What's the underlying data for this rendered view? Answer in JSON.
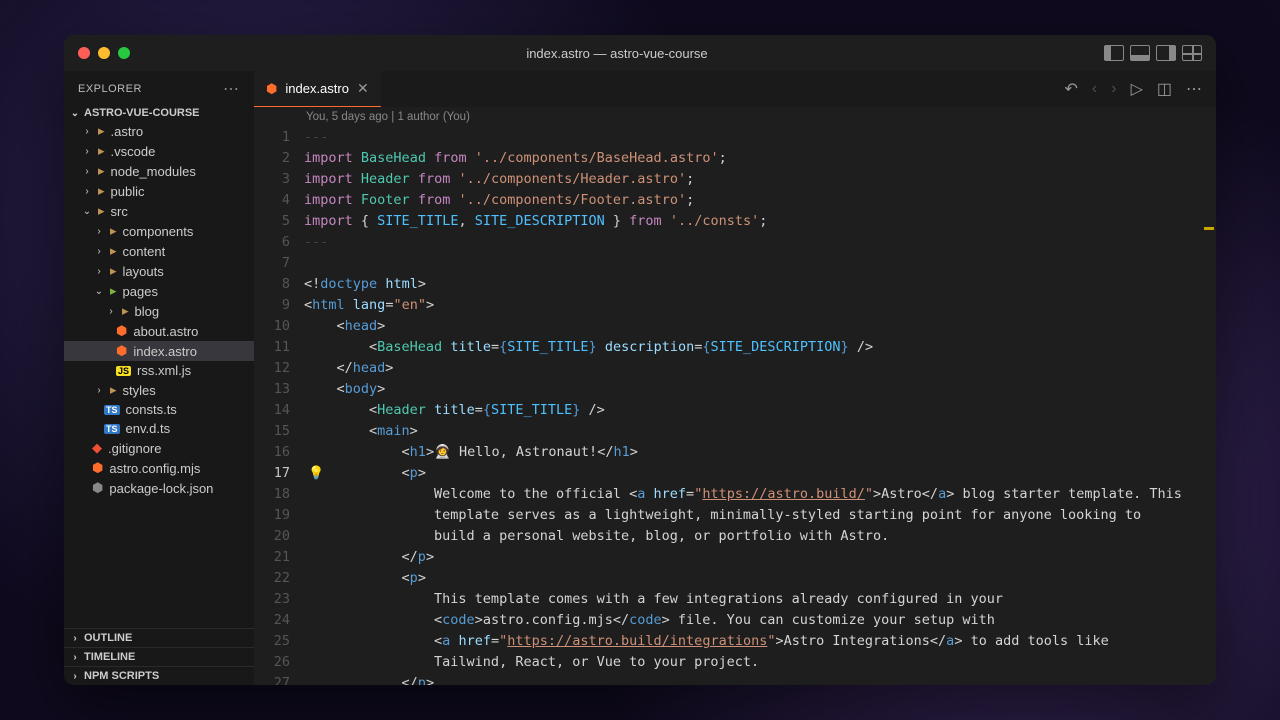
{
  "title": "index.astro — astro-vue-course",
  "traffic": {
    "close": "#ff5f57",
    "min": "#febc2e",
    "max": "#28c840"
  },
  "sidebar": {
    "explorer": "EXPLORER",
    "project": "ASTRO-VUE-COURSE",
    "tree": [
      {
        "pad": 18,
        "chev": "›",
        "icon": "fold",
        "label": ".astro"
      },
      {
        "pad": 18,
        "chev": "›",
        "icon": "fold",
        "label": ".vscode"
      },
      {
        "pad": 18,
        "chev": "›",
        "icon": "fold",
        "label": "node_modules"
      },
      {
        "pad": 18,
        "chev": "›",
        "icon": "fold",
        "label": "public"
      },
      {
        "pad": 18,
        "chev": "⌄",
        "icon": "fold",
        "label": "src"
      },
      {
        "pad": 30,
        "chev": "›",
        "icon": "fold",
        "label": "components"
      },
      {
        "pad": 30,
        "chev": "›",
        "icon": "fold",
        "label": "content"
      },
      {
        "pad": 30,
        "chev": "›",
        "icon": "fold",
        "label": "layouts"
      },
      {
        "pad": 30,
        "chev": "⌄",
        "icon": "fold pages",
        "label": "pages"
      },
      {
        "pad": 42,
        "chev": "›",
        "icon": "fold",
        "label": "blog"
      },
      {
        "pad": 52,
        "chev": "",
        "icon": "astro-f",
        "glyph": "⬢",
        "label": "about.astro"
      },
      {
        "pad": 52,
        "chev": "",
        "icon": "astro-f",
        "glyph": "⬢",
        "label": "index.astro",
        "active": true
      },
      {
        "pad": 52,
        "chev": "",
        "icon": "js-f",
        "glyph": "JS",
        "label": "rss.xml.js"
      },
      {
        "pad": 30,
        "chev": "›",
        "icon": "fold",
        "label": "styles"
      },
      {
        "pad": 40,
        "chev": "",
        "icon": "ts-f",
        "glyph": "TS",
        "label": "consts.ts"
      },
      {
        "pad": 40,
        "chev": "",
        "icon": "ts-f",
        "glyph": "TS",
        "label": "env.d.ts"
      },
      {
        "pad": 28,
        "chev": "",
        "icon": "git-f",
        "glyph": "◆",
        "label": ".gitignore"
      },
      {
        "pad": 28,
        "chev": "",
        "icon": "astro-f",
        "glyph": "⬢",
        "label": "astro.config.mjs"
      },
      {
        "pad": 28,
        "chev": "",
        "icon": "generic-f",
        "glyph": "⬢",
        "label": "package-lock.json"
      }
    ],
    "panels": [
      "OUTLINE",
      "TIMELINE",
      "NPM SCRIPTS"
    ]
  },
  "tab": {
    "label": "index.astro"
  },
  "breadcrumb": "You, 5 days ago | 1 author (You)",
  "gutter": {
    "current": 17,
    "bulb_line_idx": 16
  },
  "code_lines": [
    "<span class='hr-line'>---</span>",
    "<span class='kw'>import</span> <span class='type'>BaseHead</span> <span class='kw'>from</span> <span class='str'>'../components/BaseHead.astro'</span>;",
    "<span class='kw'>import</span> <span class='type'>Header</span> <span class='kw'>from</span> <span class='str'>'../components/Header.astro'</span>;",
    "<span class='kw'>import</span> <span class='type'>Footer</span> <span class='kw'>from</span> <span class='str'>'../components/Footer.astro'</span>;",
    "<span class='kw'>import</span> { <span class='const'>SITE_TITLE</span>, <span class='const'>SITE_DESCRIPTION</span> } <span class='kw'>from</span> <span class='str'>'../consts'</span>;",
    "<span class='hr-line'>---</span>",
    "",
    "&lt;!<span class='tag'>doctype</span> <span class='attr'>html</span>&gt;",
    "&lt;<span class='tag'>html</span> <span class='attr'>lang</span>=<span class='str'>\"en\"</span>&gt;",
    "    &lt;<span class='tag'>head</span>&gt;",
    "        &lt;<span class='type'>BaseHead</span> <span class='attr'>title</span>=<span class='brace'>{</span><span class='const'>SITE_TITLE</span><span class='brace'>}</span> <span class='attr'>description</span>=<span class='brace'>{</span><span class='const'>SITE_DESCRIPTION</span><span class='brace'>}</span> /&gt;",
    "    &lt;/<span class='tag'>head</span>&gt;",
    "    &lt;<span class='tag'>body</span>&gt;",
    "        &lt;<span class='type'>Header</span> <span class='attr'>title</span>=<span class='brace'>{</span><span class='const'>SITE_TITLE</span><span class='brace'>}</span> /&gt;",
    "        &lt;<span class='tag'>main</span>&gt;",
    "            &lt;<span class='tag'>h1</span>&gt;<span class='emoji'>🧑‍🚀</span> Hello, Astronaut!&lt;/<span class='tag'>h1</span>&gt;",
    "            &lt;<span class='tag'>p</span>&gt;",
    "                Welcome to the official &lt;<span class='tag'>a</span> <span class='attr'>href</span>=<span class='str'>\"<span class='link'>https://astro.build/</span>\"</span>&gt;Astro&lt;/<span class='tag'>a</span>&gt; blog starter template. This",
    "                template serves as a lightweight, minimally-styled starting point for anyone looking to",
    "                build a personal website, blog, or portfolio with Astro.",
    "            &lt;/<span class='tag'>p</span>&gt;",
    "            &lt;<span class='tag'>p</span>&gt;",
    "                This template comes with a few integrations already configured in your",
    "                &lt;<span class='tag'>code</span>&gt;astro.config.mjs&lt;/<span class='tag'>code</span>&gt; file. You can customize your setup with",
    "                &lt;<span class='tag'>a</span> <span class='attr'>href</span>=<span class='str'>\"<span class='link'>https://astro.build/integrations</span>\"</span>&gt;Astro Integrations&lt;/<span class='tag'>a</span>&gt; to add tools like",
    "                Tailwind, React, or Vue to your project.",
    "            &lt;/<span class='tag'>p</span>&gt;"
  ]
}
